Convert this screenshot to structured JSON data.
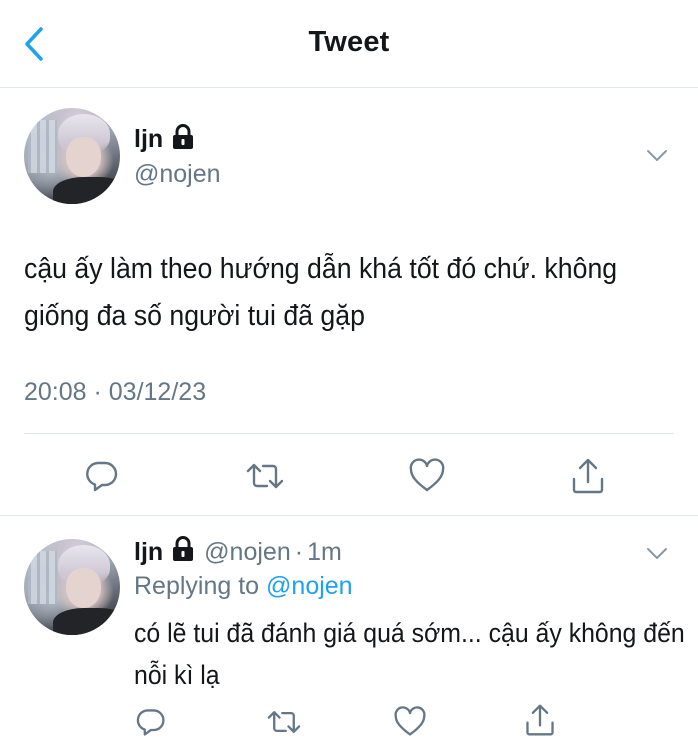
{
  "header": {
    "title": "Tweet"
  },
  "main_tweet": {
    "name": "ljn",
    "handle": "@nojen",
    "text": "cậu ấy làm theo hướng dẫn khá tốt đó chứ. không giống đa số người tui đã gặp",
    "timestamp": "20:08 · 03/12/23",
    "actions": [
      "reply-icon",
      "retweet-icon",
      "like-icon",
      "share-icon"
    ]
  },
  "reply_tweet": {
    "name": "ljn",
    "handle": "@nojen",
    "separator": "·",
    "time": "1m",
    "replying_prefix": "Replying to",
    "replying_to": "@nojen",
    "text": "có lẽ tui đã đánh giá quá sớm... cậu ấy không đến nỗi kì lạ",
    "actions": [
      "reply-icon",
      "retweet-icon",
      "like-icon",
      "share-icon"
    ]
  },
  "colors": {
    "accent": "#1da1f2",
    "secondary_text": "#657786",
    "primary_text": "#14171a",
    "border": "#e1e8ed"
  }
}
